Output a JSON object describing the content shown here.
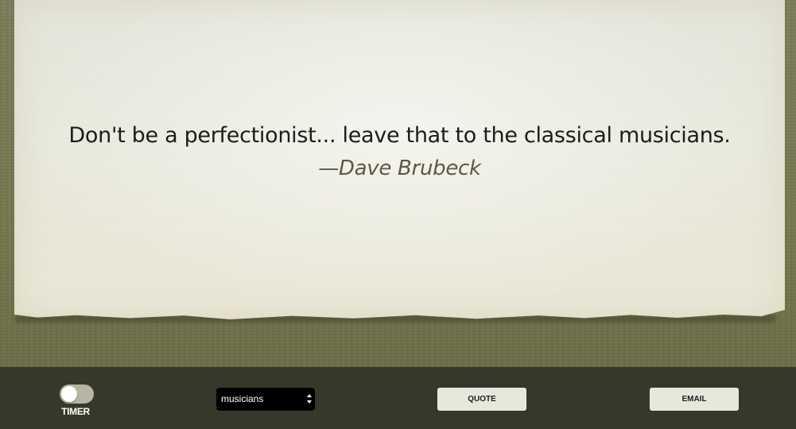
{
  "quote": {
    "text": "Don't be a perfectionist... leave that to the classical musicians.",
    "author": "—Dave Brubeck"
  },
  "controls": {
    "timer_label": "TIMER",
    "timer_enabled": false,
    "category": {
      "selected": "musicians"
    },
    "quote_button": "QUOTE",
    "email_button": "EMAIL"
  },
  "colors": {
    "background": "#77774f",
    "paper": "#e9e9dd",
    "control_bar": "#38382a",
    "button": "#e8e7dd",
    "select": "#000000"
  }
}
